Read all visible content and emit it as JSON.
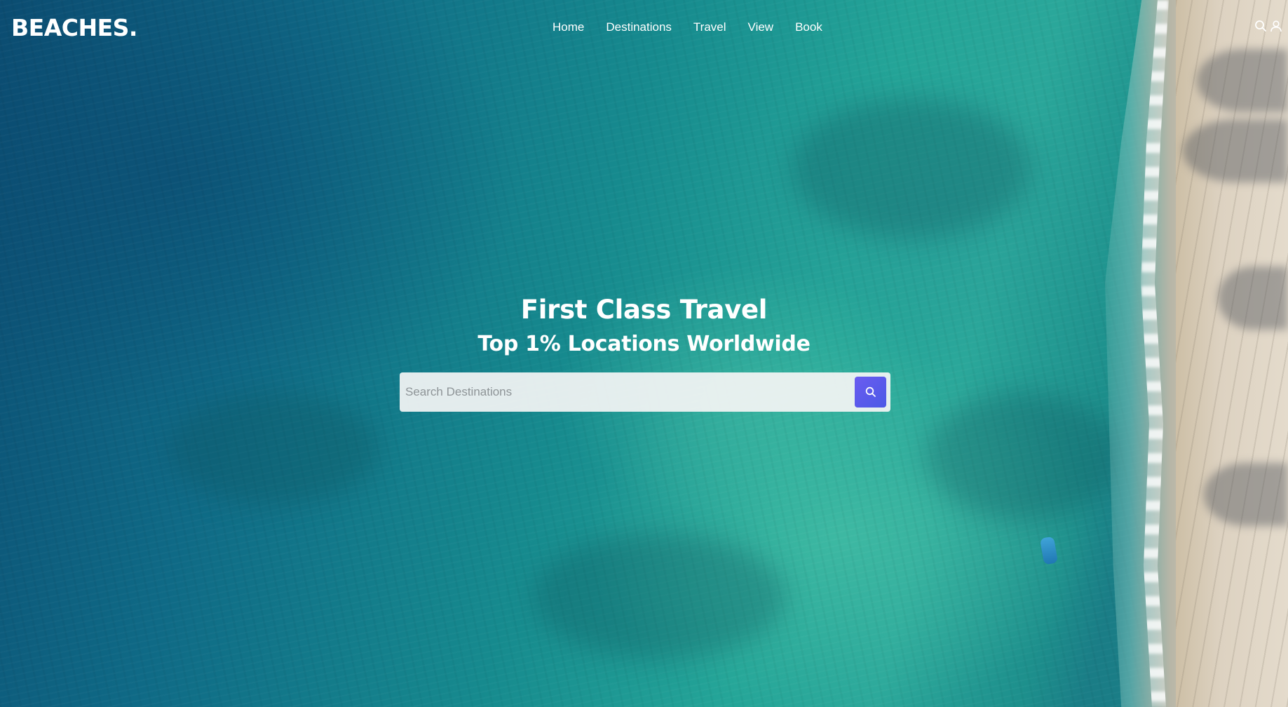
{
  "header": {
    "logo": "BEACHES.",
    "nav_items": [
      {
        "label": "Home"
      },
      {
        "label": "Destinations"
      },
      {
        "label": "Travel"
      },
      {
        "label": "View"
      },
      {
        "label": "Book"
      }
    ],
    "icons": [
      "search-icon",
      "user-icon"
    ]
  },
  "hero": {
    "headline": "First Class Travel",
    "subheadline": "Top 1% Locations Worldwide",
    "search": {
      "placeholder": "Search Destinations",
      "value": "",
      "button_icon": "search-icon"
    }
  },
  "colors": {
    "text": "#ffffff",
    "search_button": "#5b5ef0",
    "search_box_bg": "#f2f2f2"
  }
}
